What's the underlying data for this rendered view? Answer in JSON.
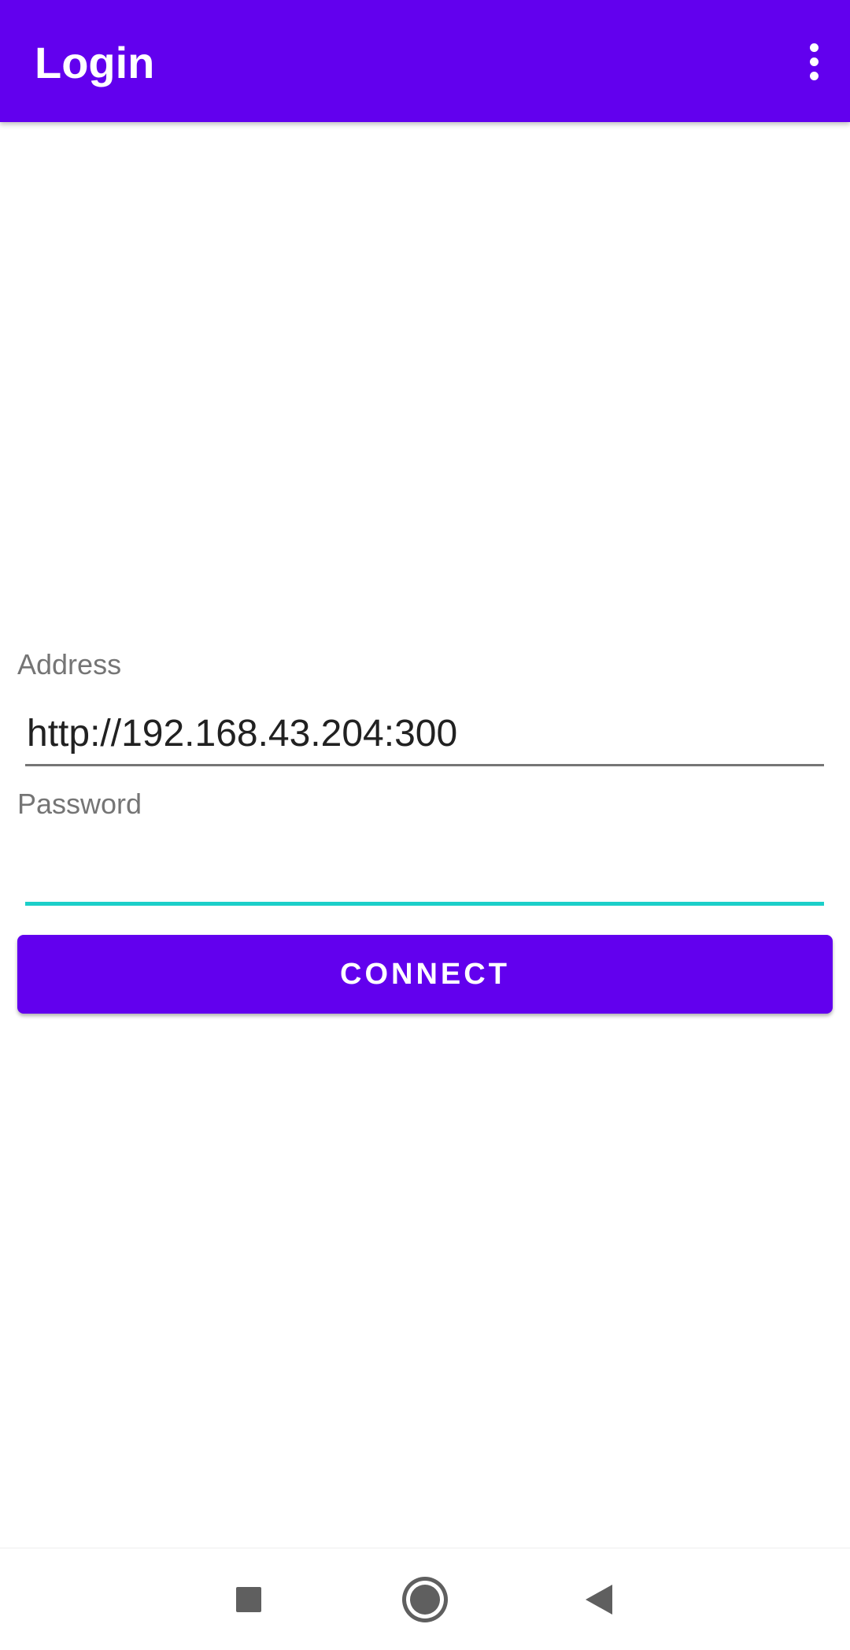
{
  "app_bar": {
    "title": "Login",
    "menu_icon": "more-vert-icon",
    "color": "#6200ee"
  },
  "form": {
    "address": {
      "label": "Address",
      "value": "http://192.168.43.204:300"
    },
    "password": {
      "label": "Password",
      "value": "",
      "focused_underline_color": "#1ccfc9"
    },
    "connect_button": {
      "label": "CONNECT",
      "color": "#6200ee"
    }
  },
  "nav_bar": {
    "recents_icon": "square-recents-icon",
    "home_icon": "circle-home-icon",
    "back_icon": "triangle-back-icon"
  }
}
